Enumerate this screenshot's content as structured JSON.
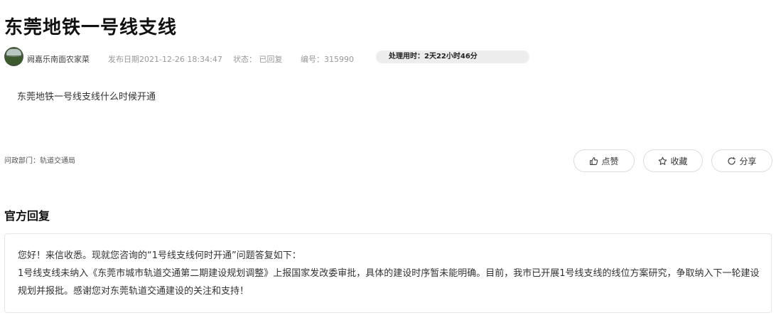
{
  "title": "东莞地铁一号线支线",
  "meta": {
    "author": "阙嘉乐南面农家菜",
    "publish_date": "发布日期2021-12-26 18:34:47",
    "status": "状态： 已回复",
    "number": "编号：315990",
    "processing_time": "处理用时：2天22小时46分"
  },
  "question": "东莞地铁一号线支线什么时候开通",
  "department": "问政部门：轨道交通局",
  "actions": {
    "like": "点赞",
    "favorite": "收藏",
    "share": "分享"
  },
  "official_reply": {
    "heading": "官方回复",
    "greeting": "您好！来信收悉。现就您咨询的“1号线支线何时开通”问题答复如下：",
    "body": "1号线支线未纳入《东莞市城市轨道交通第二期建设规划调整》上报国家发改委审批，具体的建设时序暂未能明确。目前，我市已开展1号线支线的线位方案研究，争取纳入下一轮建设规划并报批。感谢您对东莞轨道交通建设的关注和支持！"
  },
  "icons": {
    "like": "thumbs-up-icon",
    "favorite": "star-icon",
    "share": "share-icon"
  }
}
